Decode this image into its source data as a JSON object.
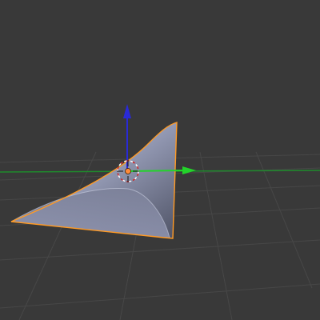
{
  "viewport": {
    "background_color": "#393939",
    "grid_color": "#474747",
    "y_axis_color": "#1f8a2c",
    "selection_outline_color": "#ff9a24",
    "mesh_fill_light": "#b5bbd6",
    "mesh_fill_dark": "#5a5f74"
  },
  "manipulator": {
    "x_axis_color": "#23d42a",
    "z_axis_color": "#2a2ad6",
    "icons": [
      "translate-z-arrow-icon",
      "translate-y-arrow-icon",
      "3d-cursor-icon",
      "object-origin-icon"
    ]
  },
  "selected_object": {
    "is_selected": true
  }
}
